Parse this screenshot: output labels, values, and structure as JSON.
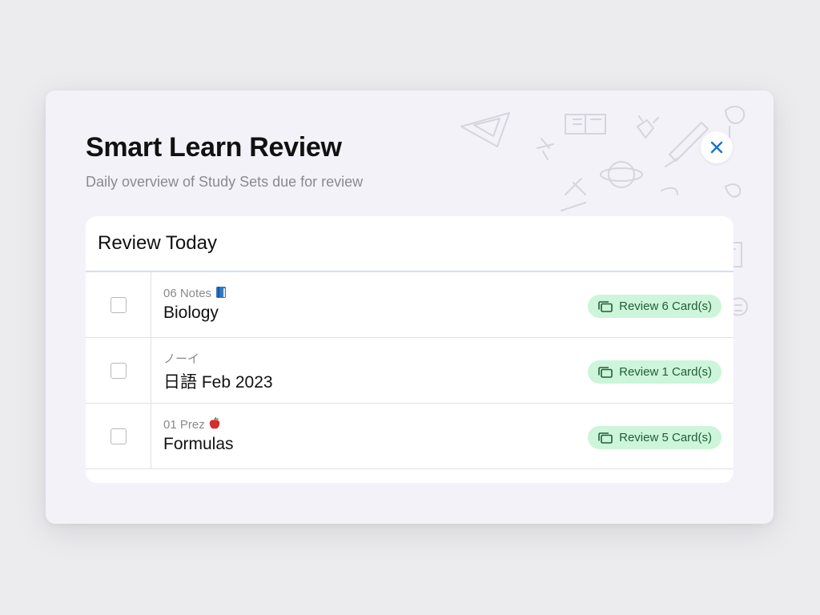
{
  "dialog": {
    "title": "Smart Learn Review",
    "subtitle": "Daily overview of Study Sets due for review",
    "close_icon": "close-icon"
  },
  "review_card": {
    "title": "Review Today",
    "rows": [
      {
        "folder": "06 Notes",
        "folder_emoji": "blue-book",
        "name": "Biology",
        "review_label": "Review 6 Card(s)",
        "checked": false
      },
      {
        "folder": "ノーイ",
        "folder_emoji": "",
        "name": "日語 Feb 2023",
        "review_label": "Review 1 Card(s)",
        "checked": false
      },
      {
        "folder": "01 Prez",
        "folder_emoji": "red-apple",
        "name": "Formulas",
        "review_label": "Review 5 Card(s)",
        "checked": false
      }
    ]
  },
  "colors": {
    "accent": "#1a73c8",
    "pill_bg": "#cdf5d9",
    "pill_text": "#1f5e34"
  }
}
